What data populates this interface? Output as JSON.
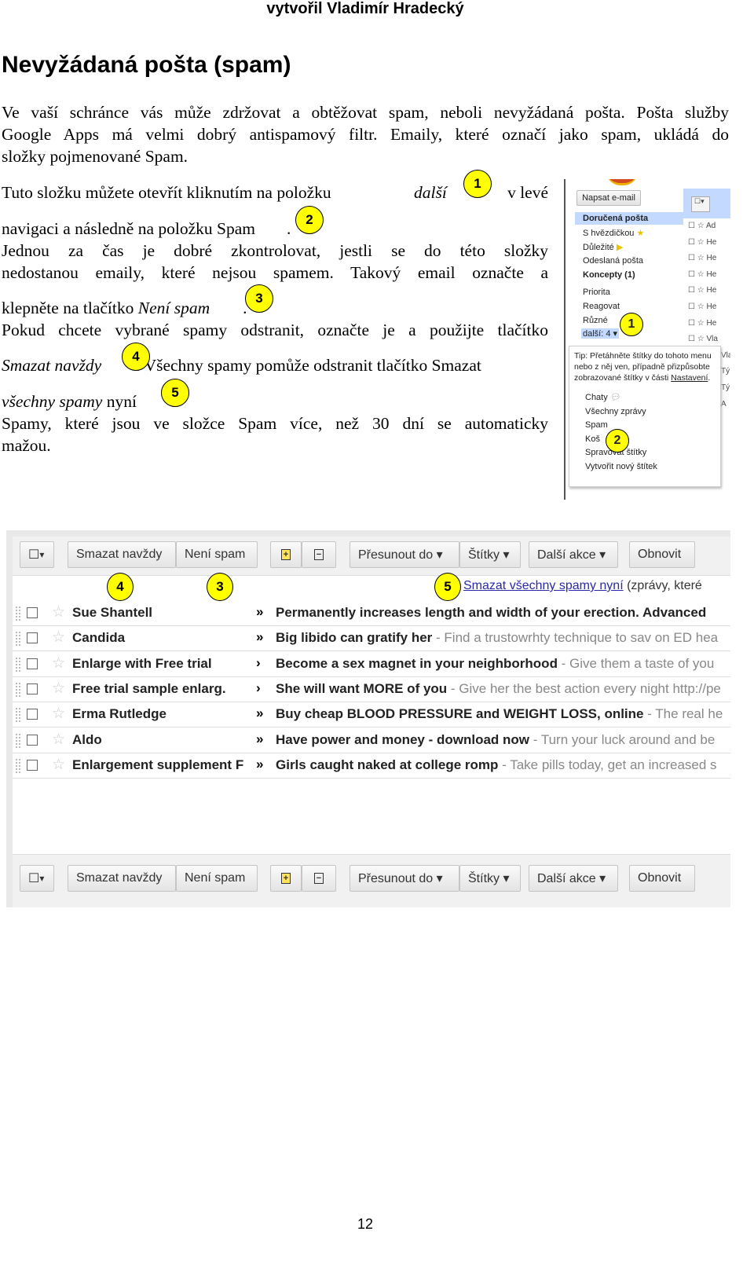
{
  "header": "vytvořil Vladimír Hradecký",
  "title": "Nevyžádaná pošta (spam)",
  "lines": [
    [
      "Ve vaší schránce vás může zdržovat a obtěžovat spam, neboli nevyžádaná pošta. Pošta služby"
    ],
    [
      "Google Apps má velmi dobrý antispamový filtr. Emaily, které označí jako spam, ukládá do"
    ],
    [
      "složky pojmenované Spam."
    ],
    [
      "Tuto složku můžete otevřít kliknutím na položku",
      "další",
      "v levé"
    ],
    [
      "navigaci a následně na položku Spam",
      "."
    ],
    [
      "Jednou za čas je dobré zkontrolovat, jestli se do této složky"
    ],
    [
      "nedostanou emaily, které nejsou spamem. Takový email označte a"
    ],
    [
      "klepněte na tlačítko ",
      "Není spam",
      "."
    ],
    [
      "Pokud chcete vybrané spamy odstranit, označte je a použijte tlačítko"
    ],
    [
      "Smazat navždy",
      ". Všechny spamy pomůže odstranit tlačítko Smazat"
    ],
    [
      "všechny spamy",
      " nyní",
      "."
    ],
    [
      "Spamy, které jsou ve složce Spam více, než 30 dní se automaticky"
    ],
    [
      "mažou."
    ]
  ],
  "markers": [
    "1",
    "2",
    "3",
    "4",
    "5"
  ],
  "marker_color": "#ffff00",
  "sidebar": {
    "compose": "Napsat e-mail",
    "items": [
      "Doručená pošta",
      "S hvězdičkou",
      "Důležité",
      "Odeslaná pošta",
      "Koncepty (1)",
      "Priorita",
      "Reagovat",
      "Různé",
      "další: 4 ▾"
    ],
    "tip": "Tip: Přetáhněte štítky do tohoto menu nebo z něj ven, případně přizpůsobte zobrazované štítky v části ",
    "tip_link": "Nastavení",
    "more_items": [
      "Chaty",
      "Všechny zprávy",
      "Spam",
      "Koš",
      "Spravovat štítky",
      "Vytvořit nový štítek"
    ],
    "list_peek": [
      "Ad",
      "He",
      "He",
      "He",
      "He",
      "He",
      "He",
      "Vla",
      "Vla",
      "Tý",
      "Tý",
      "A"
    ]
  },
  "toolbar": {
    "select": "▾",
    "delete": "Smazat navždy",
    "not_spam": "Není spam",
    "plus": "+",
    "minus": "−",
    "move": "Přesunout do ▾",
    "labels": "Štítky ▾",
    "more": "Další akce ▾",
    "refresh": "Obnovit"
  },
  "delete_all_link": "Smazat všechny spamy nyní",
  "delete_all_note": " (zprávy, které",
  "emails": [
    {
      "sender": "Sue Shantell",
      "subject": "Permanently increases length and width of your erection. Advanced",
      "snippet": ""
    },
    {
      "sender": "Candida",
      "subject": "Big libido can gratify her",
      "snippet": " - Find a trustowrhty technique to sav on ED hea"
    },
    {
      "sender": "Enlarge with Free trial",
      "subject": "Become a sex magnet in your neighborhood",
      "snippet": " - Give them a taste of you"
    },
    {
      "sender": "Free trial sample enlarg.",
      "subject": "She will want MORE of you",
      "snippet": " - Give her the best action every night http://pe"
    },
    {
      "sender": "Erma Rutledge",
      "subject": "Buy cheap BLOOD PRESSURE and WEIGHT LOSS, online",
      "snippet": " - The real he"
    },
    {
      "sender": "Aldo",
      "subject": "Have power and money - download now",
      "snippet": " - Turn your luck around and be"
    },
    {
      "sender": "Enlargement supplement F",
      "subject": "Girls caught naked at college romp",
      "snippet": " - Take pills today, get an increased s"
    }
  ],
  "page_number": "12"
}
